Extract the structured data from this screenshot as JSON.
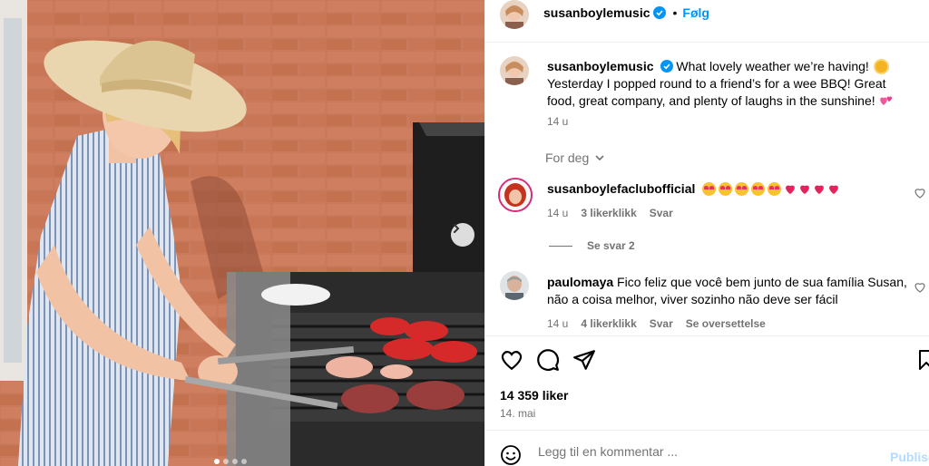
{
  "post": {
    "author": "susanboylemusic",
    "follow_label": "Følg",
    "caption_text": "What lovely weather we’re having! ",
    "caption_text_2": "Yesterday I popped round to a friend’s for a wee BBQ! Great food, great company, and plenty of laughs in the sunshine!",
    "caption_age": "14 u",
    "for_you_label": "For deg",
    "likes": "14 359 liker",
    "date": "14. mai",
    "comment_placeholder": "Legg til en kommentar ...",
    "publish_label": "Publiser"
  },
  "comments": [
    {
      "username": "susanboylefaclubofficial",
      "age": "14 u",
      "likes": "3 likerklikk",
      "reply_label": "Svar",
      "view_replies": "Se svar 2"
    },
    {
      "username": "paulomaya",
      "text": "Fico feliz que você bem junto de sua família Susan, não a coisa melhor, viver sozinho não deve ser fácil",
      "age": "14 u",
      "likes": "4 likerklikk",
      "reply_label": "Svar",
      "translate_label": "Se oversettelse"
    }
  ],
  "icons": {
    "verified": "verified-badge-icon",
    "like": "heart-icon",
    "comment": "speech-bubble-icon",
    "share": "paper-plane-icon",
    "save": "bookmark-icon",
    "emoji": "smiley-icon",
    "next": "chevron-right-icon"
  },
  "colors": {
    "accent": "#0095f6",
    "verified": "#0095f6",
    "muted": "#737373",
    "publish_disabled": "#b3dbff"
  },
  "carousel": {
    "slides": 4,
    "active": 1
  }
}
